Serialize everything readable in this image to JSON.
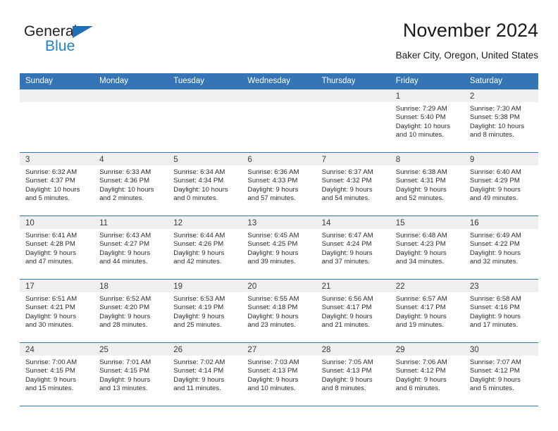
{
  "brand": {
    "name_part1": "General",
    "name_part2": "Blue",
    "accent_color": "#1e7fd0",
    "triangle_color": "#1e6fb8"
  },
  "header": {
    "title": "November 2024",
    "subtitle": "Baker City, Oregon, United States"
  },
  "calendar": {
    "header_color": "#3574b5",
    "date_band_color": "#efeff0",
    "weekdays": [
      "Sunday",
      "Monday",
      "Tuesday",
      "Wednesday",
      "Thursday",
      "Friday",
      "Saturday"
    ],
    "weeks": [
      {
        "days": [
          {
            "date": "",
            "sunrise": "",
            "sunset": "",
            "daylight_line1": "",
            "daylight_line2": ""
          },
          {
            "date": "",
            "sunrise": "",
            "sunset": "",
            "daylight_line1": "",
            "daylight_line2": ""
          },
          {
            "date": "",
            "sunrise": "",
            "sunset": "",
            "daylight_line1": "",
            "daylight_line2": ""
          },
          {
            "date": "",
            "sunrise": "",
            "sunset": "",
            "daylight_line1": "",
            "daylight_line2": ""
          },
          {
            "date": "",
            "sunrise": "",
            "sunset": "",
            "daylight_line1": "",
            "daylight_line2": ""
          },
          {
            "date": "1",
            "sunrise": "Sunrise: 7:29 AM",
            "sunset": "Sunset: 5:40 PM",
            "daylight_line1": "Daylight: 10 hours",
            "daylight_line2": "and 10 minutes."
          },
          {
            "date": "2",
            "sunrise": "Sunrise: 7:30 AM",
            "sunset": "Sunset: 5:38 PM",
            "daylight_line1": "Daylight: 10 hours",
            "daylight_line2": "and 8 minutes."
          }
        ]
      },
      {
        "days": [
          {
            "date": "3",
            "sunrise": "Sunrise: 6:32 AM",
            "sunset": "Sunset: 4:37 PM",
            "daylight_line1": "Daylight: 10 hours",
            "daylight_line2": "and 5 minutes."
          },
          {
            "date": "4",
            "sunrise": "Sunrise: 6:33 AM",
            "sunset": "Sunset: 4:36 PM",
            "daylight_line1": "Daylight: 10 hours",
            "daylight_line2": "and 2 minutes."
          },
          {
            "date": "5",
            "sunrise": "Sunrise: 6:34 AM",
            "sunset": "Sunset: 4:34 PM",
            "daylight_line1": "Daylight: 10 hours",
            "daylight_line2": "and 0 minutes."
          },
          {
            "date": "6",
            "sunrise": "Sunrise: 6:36 AM",
            "sunset": "Sunset: 4:33 PM",
            "daylight_line1": "Daylight: 9 hours",
            "daylight_line2": "and 57 minutes."
          },
          {
            "date": "7",
            "sunrise": "Sunrise: 6:37 AM",
            "sunset": "Sunset: 4:32 PM",
            "daylight_line1": "Daylight: 9 hours",
            "daylight_line2": "and 54 minutes."
          },
          {
            "date": "8",
            "sunrise": "Sunrise: 6:38 AM",
            "sunset": "Sunset: 4:31 PM",
            "daylight_line1": "Daylight: 9 hours",
            "daylight_line2": "and 52 minutes."
          },
          {
            "date": "9",
            "sunrise": "Sunrise: 6:40 AM",
            "sunset": "Sunset: 4:29 PM",
            "daylight_line1": "Daylight: 9 hours",
            "daylight_line2": "and 49 minutes."
          }
        ]
      },
      {
        "days": [
          {
            "date": "10",
            "sunrise": "Sunrise: 6:41 AM",
            "sunset": "Sunset: 4:28 PM",
            "daylight_line1": "Daylight: 9 hours",
            "daylight_line2": "and 47 minutes."
          },
          {
            "date": "11",
            "sunrise": "Sunrise: 6:43 AM",
            "sunset": "Sunset: 4:27 PM",
            "daylight_line1": "Daylight: 9 hours",
            "daylight_line2": "and 44 minutes."
          },
          {
            "date": "12",
            "sunrise": "Sunrise: 6:44 AM",
            "sunset": "Sunset: 4:26 PM",
            "daylight_line1": "Daylight: 9 hours",
            "daylight_line2": "and 42 minutes."
          },
          {
            "date": "13",
            "sunrise": "Sunrise: 6:45 AM",
            "sunset": "Sunset: 4:25 PM",
            "daylight_line1": "Daylight: 9 hours",
            "daylight_line2": "and 39 minutes."
          },
          {
            "date": "14",
            "sunrise": "Sunrise: 6:47 AM",
            "sunset": "Sunset: 4:24 PM",
            "daylight_line1": "Daylight: 9 hours",
            "daylight_line2": "and 37 minutes."
          },
          {
            "date": "15",
            "sunrise": "Sunrise: 6:48 AM",
            "sunset": "Sunset: 4:23 PM",
            "daylight_line1": "Daylight: 9 hours",
            "daylight_line2": "and 34 minutes."
          },
          {
            "date": "16",
            "sunrise": "Sunrise: 6:49 AM",
            "sunset": "Sunset: 4:22 PM",
            "daylight_line1": "Daylight: 9 hours",
            "daylight_line2": "and 32 minutes."
          }
        ]
      },
      {
        "days": [
          {
            "date": "17",
            "sunrise": "Sunrise: 6:51 AM",
            "sunset": "Sunset: 4:21 PM",
            "daylight_line1": "Daylight: 9 hours",
            "daylight_line2": "and 30 minutes."
          },
          {
            "date": "18",
            "sunrise": "Sunrise: 6:52 AM",
            "sunset": "Sunset: 4:20 PM",
            "daylight_line1": "Daylight: 9 hours",
            "daylight_line2": "and 28 minutes."
          },
          {
            "date": "19",
            "sunrise": "Sunrise: 6:53 AM",
            "sunset": "Sunset: 4:19 PM",
            "daylight_line1": "Daylight: 9 hours",
            "daylight_line2": "and 25 minutes."
          },
          {
            "date": "20",
            "sunrise": "Sunrise: 6:55 AM",
            "sunset": "Sunset: 4:18 PM",
            "daylight_line1": "Daylight: 9 hours",
            "daylight_line2": "and 23 minutes."
          },
          {
            "date": "21",
            "sunrise": "Sunrise: 6:56 AM",
            "sunset": "Sunset: 4:17 PM",
            "daylight_line1": "Daylight: 9 hours",
            "daylight_line2": "and 21 minutes."
          },
          {
            "date": "22",
            "sunrise": "Sunrise: 6:57 AM",
            "sunset": "Sunset: 4:17 PM",
            "daylight_line1": "Daylight: 9 hours",
            "daylight_line2": "and 19 minutes."
          },
          {
            "date": "23",
            "sunrise": "Sunrise: 6:58 AM",
            "sunset": "Sunset: 4:16 PM",
            "daylight_line1": "Daylight: 9 hours",
            "daylight_line2": "and 17 minutes."
          }
        ]
      },
      {
        "days": [
          {
            "date": "24",
            "sunrise": "Sunrise: 7:00 AM",
            "sunset": "Sunset: 4:15 PM",
            "daylight_line1": "Daylight: 9 hours",
            "daylight_line2": "and 15 minutes."
          },
          {
            "date": "25",
            "sunrise": "Sunrise: 7:01 AM",
            "sunset": "Sunset: 4:15 PM",
            "daylight_line1": "Daylight: 9 hours",
            "daylight_line2": "and 13 minutes."
          },
          {
            "date": "26",
            "sunrise": "Sunrise: 7:02 AM",
            "sunset": "Sunset: 4:14 PM",
            "daylight_line1": "Daylight: 9 hours",
            "daylight_line2": "and 11 minutes."
          },
          {
            "date": "27",
            "sunrise": "Sunrise: 7:03 AM",
            "sunset": "Sunset: 4:13 PM",
            "daylight_line1": "Daylight: 9 hours",
            "daylight_line2": "and 10 minutes."
          },
          {
            "date": "28",
            "sunrise": "Sunrise: 7:05 AM",
            "sunset": "Sunset: 4:13 PM",
            "daylight_line1": "Daylight: 9 hours",
            "daylight_line2": "and 8 minutes."
          },
          {
            "date": "29",
            "sunrise": "Sunrise: 7:06 AM",
            "sunset": "Sunset: 4:12 PM",
            "daylight_line1": "Daylight: 9 hours",
            "daylight_line2": "and 6 minutes."
          },
          {
            "date": "30",
            "sunrise": "Sunrise: 7:07 AM",
            "sunset": "Sunset: 4:12 PM",
            "daylight_line1": "Daylight: 9 hours",
            "daylight_line2": "and 5 minutes."
          }
        ]
      }
    ]
  }
}
